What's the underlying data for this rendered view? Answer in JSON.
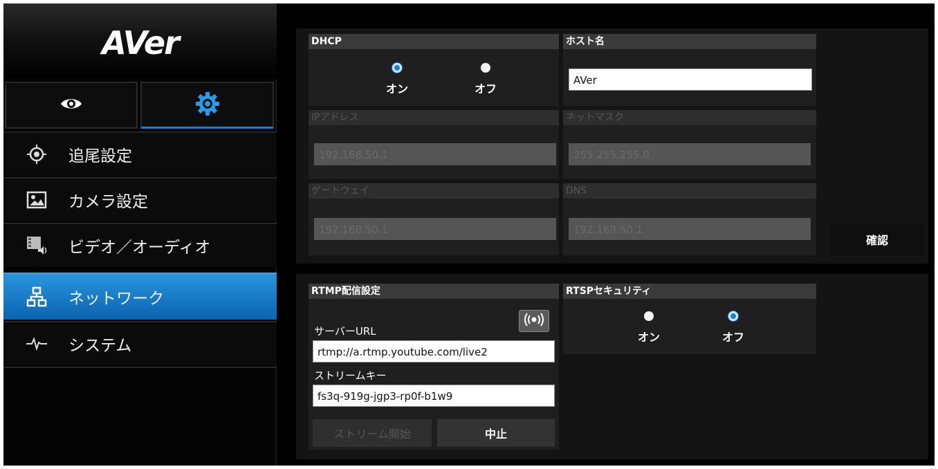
{
  "logo": {
    "text": "AVer"
  },
  "mode_tabs": {
    "preview_icon": "eye-icon",
    "settings_icon": "gear-icon"
  },
  "colors": {
    "accent": "#1a7fd4",
    "active_nav": "#1a7fd4",
    "radio_checked": "#1e7fe0",
    "panel_bg": "#141414"
  },
  "sidebar": {
    "items": [
      {
        "label": "追尾設定",
        "icon": "tracking-icon"
      },
      {
        "label": "カメラ設定",
        "icon": "image-icon"
      },
      {
        "label": "ビデオ／オーディオ",
        "icon": "video-audio-icon"
      },
      {
        "label": "ネットワーク",
        "icon": "network-icon",
        "active": true
      },
      {
        "label": "システム",
        "icon": "pulse-icon"
      }
    ]
  },
  "network": {
    "dhcp": {
      "title": "DHCP",
      "on_label": "オン",
      "off_label": "オフ",
      "selected": "on"
    },
    "hostname": {
      "title": "ホスト名",
      "value": "AVer"
    },
    "ip": {
      "title": "IPアドレス",
      "value": "192.168.50.1"
    },
    "netmask": {
      "title": "ネットマスク",
      "value": "255.255.255.0"
    },
    "gateway": {
      "title": "ゲートウェイ",
      "value": "192.168.50.1"
    },
    "dns": {
      "title": "DNS",
      "value": "192.168.50.1"
    },
    "confirm_label": "確認"
  },
  "stream": {
    "rtmp": {
      "title": "RTMP配信設定",
      "server_label": "サーバーURL",
      "server_value": "rtmp://a.rtmp.youtube.com/live2",
      "key_label": "ストリームキー",
      "key_value": "fs3q-919g-jgp3-rp0f-b1w9",
      "start_label": "ストリーム開始",
      "stop_label": "中止",
      "broadcast_icon": "broadcast-icon"
    },
    "rtsp": {
      "title": "RTSPセキュリティ",
      "on_label": "オン",
      "off_label": "オフ",
      "selected": "off"
    }
  }
}
